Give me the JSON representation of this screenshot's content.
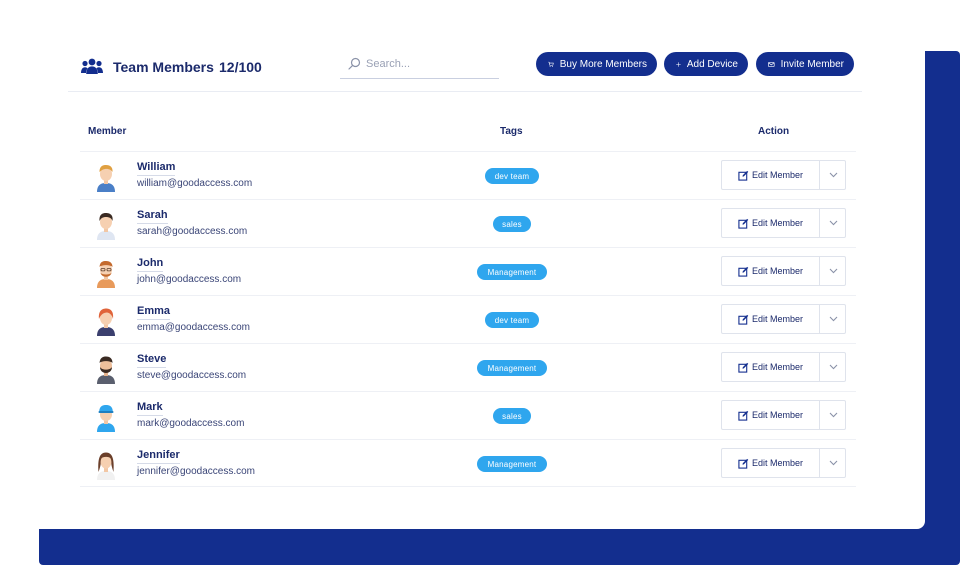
{
  "colors": {
    "navy": "#132e8e",
    "text": "#1b2a6b",
    "tag": "#2fa6ee",
    "border": "#dfe3ec"
  },
  "header": {
    "icon": "team-icon",
    "title": "Team Members",
    "count": "12/100"
  },
  "search": {
    "placeholder": "Search...",
    "value": "",
    "icon": "search-icon"
  },
  "buttons": {
    "buy": {
      "label": "Buy More Members",
      "icon": "cart-icon"
    },
    "add": {
      "label": "Add Device",
      "icon": "plus-icon"
    },
    "invite": {
      "label": "Invite Member",
      "icon": "envelope-icon"
    }
  },
  "table": {
    "columns": {
      "member": "Member",
      "tags": "Tags",
      "action": "Action"
    },
    "edit_label": "Edit Member",
    "rows": [
      {
        "name": "William",
        "email": "william@goodaccess.com",
        "tag": "dev team"
      },
      {
        "name": "Sarah",
        "email": "sarah@goodaccess.com",
        "tag": "sales"
      },
      {
        "name": "John",
        "email": "john@goodaccess.com",
        "tag": "Management"
      },
      {
        "name": "Emma",
        "email": "emma@goodaccess.com",
        "tag": "dev team"
      },
      {
        "name": "Steve",
        "email": "steve@goodaccess.com",
        "tag": "Management"
      },
      {
        "name": "Mark",
        "email": "mark@goodaccess.com",
        "tag": "sales"
      },
      {
        "name": "Jennifer",
        "email": "jennifer@goodaccess.com",
        "tag": "Management"
      }
    ]
  }
}
